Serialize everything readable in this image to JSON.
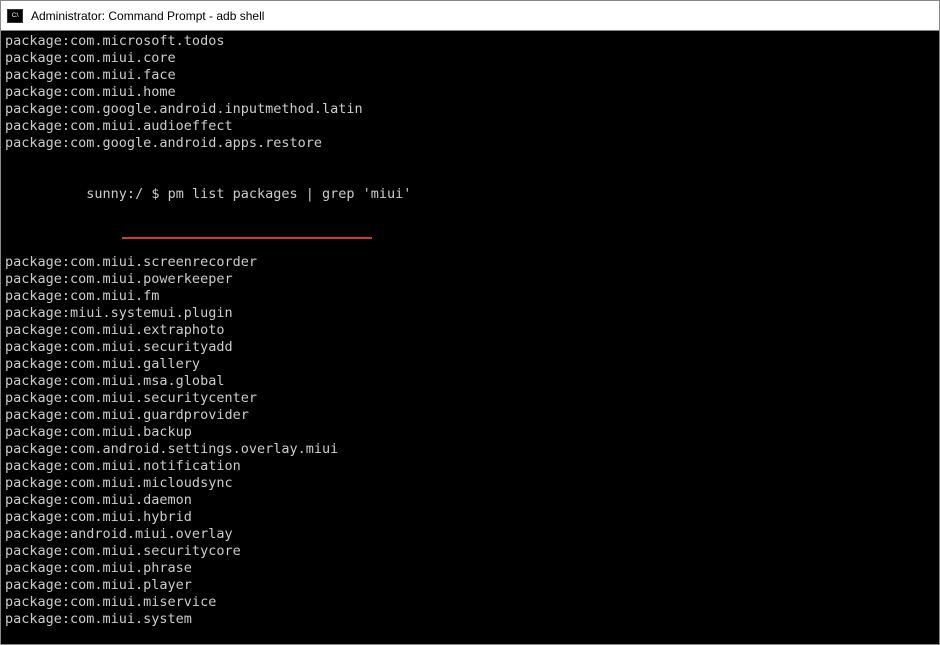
{
  "titlebar": {
    "title": "Administrator: Command Prompt - adb  shell"
  },
  "terminal": {
    "prompt": {
      "host": "sunny:/ $ ",
      "command": "pm list packages | grep 'miui'"
    },
    "lines_before": [
      "package:com.microsoft.todos",
      "package:com.miui.core",
      "package:com.miui.face",
      "package:com.miui.home",
      "package:com.google.android.inputmethod.latin",
      "package:com.miui.audioeffect",
      "package:com.google.android.apps.restore"
    ],
    "lines_after": [
      "package:com.miui.screenrecorder",
      "package:com.miui.powerkeeper",
      "package:com.miui.fm",
      "package:miui.systemui.plugin",
      "package:com.miui.extraphoto",
      "package:com.miui.securityadd",
      "package:com.miui.gallery",
      "package:com.miui.msa.global",
      "package:com.miui.securitycenter",
      "package:com.miui.guardprovider",
      "package:com.miui.backup",
      "package:com.android.settings.overlay.miui",
      "package:com.miui.notification",
      "package:com.miui.micloudsync",
      "package:com.miui.daemon",
      "package:com.miui.hybrid",
      "package:android.miui.overlay",
      "package:com.miui.securitycore",
      "package:com.miui.phrase",
      "package:com.miui.player",
      "package:com.miui.miservice",
      "package:com.miui.system"
    ]
  }
}
